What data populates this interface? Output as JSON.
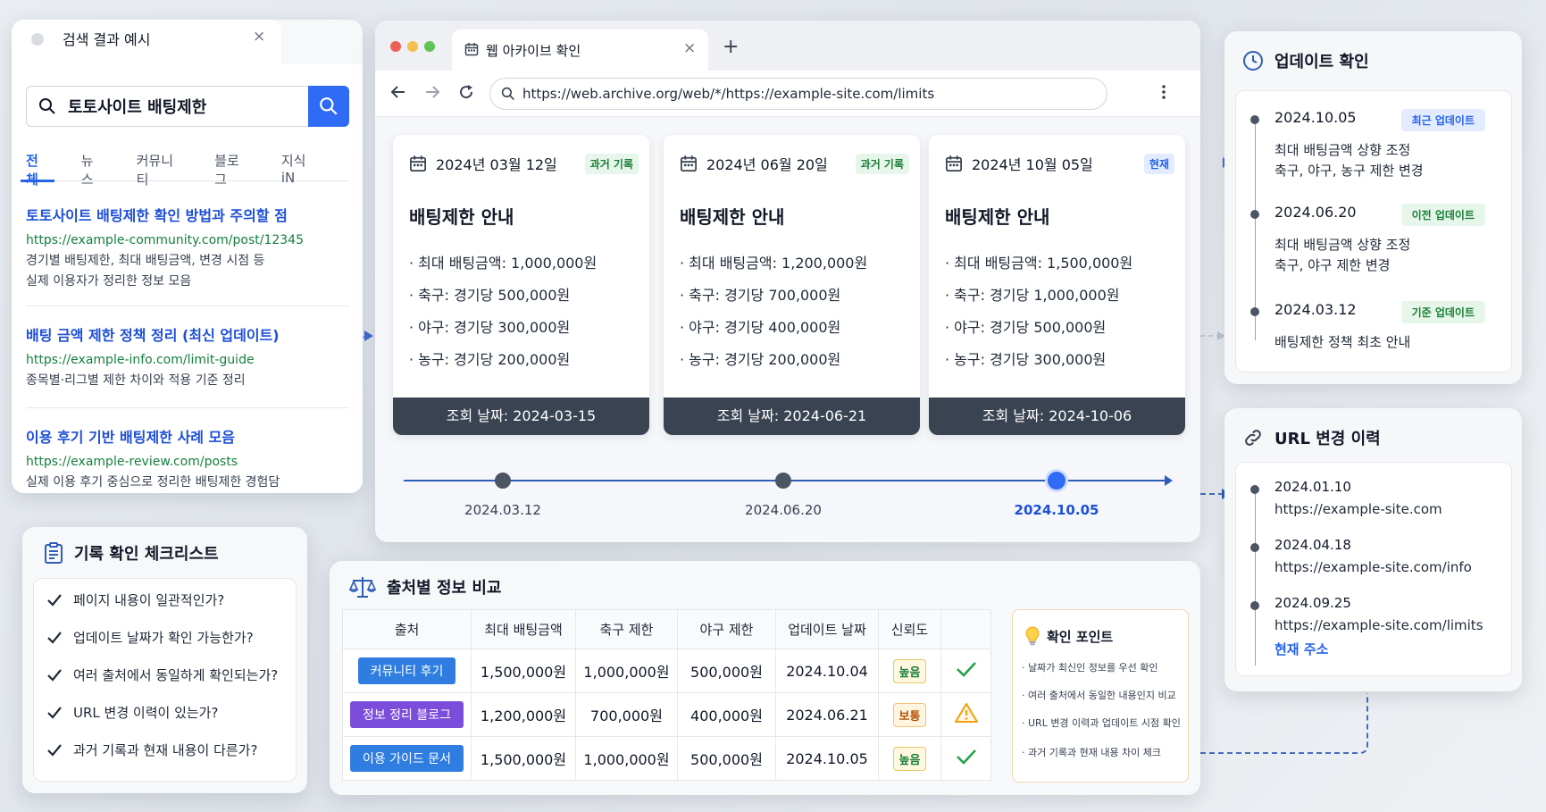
{
  "search": {
    "tab_title": "검색 결과 예시",
    "tab_close": "×",
    "query": "토토사이트 배팅제한",
    "tabs": [
      "전체",
      "뉴스",
      "커뮤니티",
      "블로그",
      "지식iN"
    ],
    "results": [
      {
        "title": "토토사이트 배팅제한 확인 방법과 주의할 점",
        "url": "https://example-community.com/post/12345",
        "desc1": "경기별 배팅제한, 최대 배팅금액, 변경 시점 등",
        "desc2": "실제 이용자가 정리한 정보 모음"
      },
      {
        "title": "배팅 금액 제한 정책 정리 (최신 업데이트)",
        "url": "https://example-info.com/limit-guide",
        "desc1": "종목별·리그별 제한 차이와 적용 기준 정리",
        "desc2": ""
      },
      {
        "title": "이용 후기 기반 배팅제한 사례 모음",
        "url": "https://example-review.com/posts",
        "desc1": "실제 이용 후기 중심으로 정리한 배팅제한 경험담",
        "desc2": ""
      }
    ]
  },
  "browser": {
    "tab_label": "웹 아카이브 확인",
    "tab_close": "×",
    "new_tab": "+",
    "url": "https://web.archive.org/web/*/https://example-site.com/limits",
    "snapshots": [
      {
        "date": "2024년 03월 12일",
        "badge": "과거 기록",
        "title": "배팅제한 안내",
        "items": [
          "최대 배팅금액: 1,000,000원",
          "축구: 경기당 500,000원",
          "야구: 경기당 300,000원",
          "농구: 경기당 200,000원"
        ],
        "footer": "조회 날짜: 2024-03-15"
      },
      {
        "date": "2024년 06월 20일",
        "badge": "과거 기록",
        "title": "배팅제한 안내",
        "items": [
          "최대 배팅금액: 1,200,000원",
          "축구: 경기당 700,000원",
          "야구: 경기당 400,000원",
          "농구: 경기당 200,000원"
        ],
        "footer": "조회 날짜: 2024-06-21"
      },
      {
        "date": "2024년 10월 05일",
        "badge": "현재",
        "title": "배팅제한 안내",
        "items": [
          "최대 배팅금액: 1,500,000원",
          "축구: 경기당 1,000,000원",
          "야구: 경기당 500,000원",
          "농구: 경기당 300,000원"
        ],
        "footer": "조회 날짜: 2024-10-06"
      }
    ],
    "timeline": [
      "2024.03.12",
      "2024.06.20",
      "2024.10.05"
    ]
  },
  "updates": {
    "title": "업데이트 확인",
    "entries": [
      {
        "date": "2024.10.05",
        "tag": "최근 업데이트",
        "line1": "최대 배팅금액 상향 조정",
        "line2": "축구, 야구, 농구 제한 변경"
      },
      {
        "date": "2024.06.20",
        "tag": "이전 업데이트",
        "line1": "최대 배팅금액 상향 조정",
        "line2": "축구, 야구 제한 변경"
      },
      {
        "date": "2024.03.12",
        "tag": "기준 업데이트",
        "line1": "배팅제한 정책 최초 안내",
        "line2": ""
      }
    ]
  },
  "url_history": {
    "title": "URL 변경 이력",
    "entries": [
      {
        "date": "2024.01.10",
        "url": "https://example-site.com"
      },
      {
        "date": "2024.04.18",
        "url": "https://example-site.com/info"
      },
      {
        "date": "2024.09.25",
        "url": "https://example-site.com/limits",
        "current": "현재 주소"
      }
    ]
  },
  "checklist": {
    "title": "기록 확인 체크리스트",
    "items": [
      "페이지 내용이 일관적인가?",
      "업데이트 날짜가 확인 가능한가?",
      "여러 출처에서 동일하게 확인되는가?",
      "URL 변경 이력이 있는가?",
      "과거 기록과 현재 내용이 다른가?"
    ]
  },
  "compare": {
    "title": "출처별 정보 비교",
    "headers": [
      "출처",
      "최대 배팅금액",
      "축구 제한",
      "야구 제한",
      "업데이트 날짜",
      "신뢰도",
      ""
    ],
    "rows": [
      {
        "source": "커뮤니티 후기",
        "max": "1,500,000원",
        "soccer": "1,000,000원",
        "baseball": "500,000원",
        "updated": "2024.10.04",
        "trust": "높음"
      },
      {
        "source": "정보 정리 블로그",
        "max": "1,200,000원",
        "soccer": "700,000원",
        "baseball": "400,000원",
        "updated": "2024.06.21",
        "trust": "보통"
      },
      {
        "source": "이용 가이드 문서",
        "max": "1,500,000원",
        "soccer": "1,000,000원",
        "baseball": "500,000원",
        "updated": "2024.10.05",
        "trust": "높음"
      }
    ],
    "tips_title": "확인 포인트",
    "tips": [
      "· 날짜가 최신인 정보를 우선 확인",
      "· 여러 출처에서 동일한 내용인지 비교",
      "· URL 변경 이력과 업데이트 시점 확인",
      "· 과거 기록과 현재 내용 차이 체크"
    ]
  },
  "colors": {
    "accent": "#2f6bf5",
    "chip_community": "#2f7de1",
    "chip_blog": "#7c4ddb",
    "chip_guide": "#2f7de1",
    "check_green": "#22a34a",
    "warn_orange": "#f59e0b"
  }
}
